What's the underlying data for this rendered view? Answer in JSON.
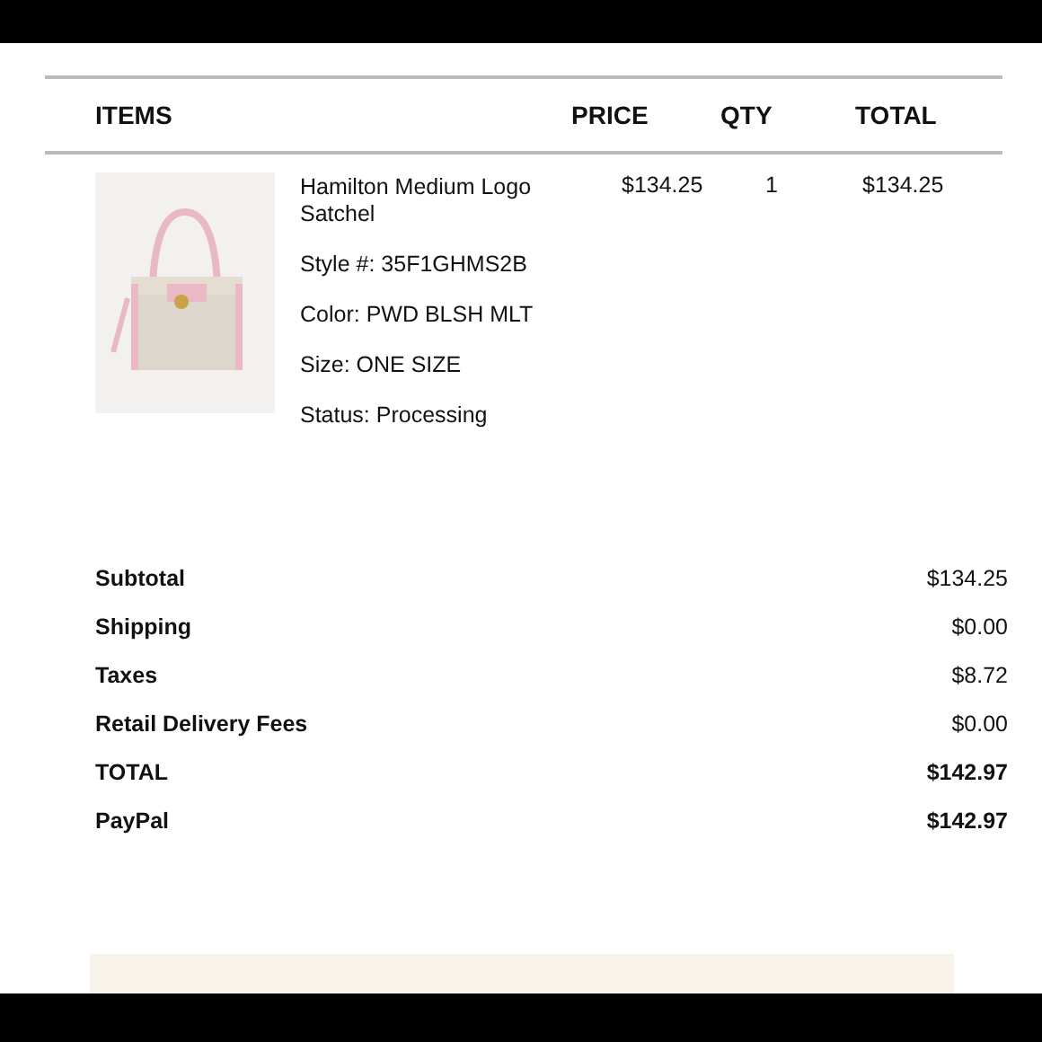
{
  "table": {
    "columns": [
      "ITEMS",
      "PRICE",
      "QTY",
      "TOTAL"
    ],
    "rows": [
      {
        "name": "Hamilton Medium Logo Satchel",
        "details": [
          "Style #: 35F1GHMS2B",
          "Color: PWD BLSH MLT",
          "Size: ONE SIZE",
          "Status: Processing"
        ],
        "price": "$134.25",
        "qty": "1",
        "total": "$134.25"
      }
    ]
  },
  "summary": [
    {
      "label": "Subtotal",
      "value": "$134.25",
      "emphasis": false
    },
    {
      "label": "Shipping",
      "value": "$0.00",
      "emphasis": false
    },
    {
      "label": "Taxes",
      "value": "$8.72",
      "emphasis": false
    },
    {
      "label": "Retail Delivery Fees",
      "value": "$0.00",
      "emphasis": false
    },
    {
      "label": "TOTAL",
      "value": "$142.97",
      "emphasis": true
    },
    {
      "label": "PayPal",
      "value": "$142.97",
      "emphasis": true
    }
  ]
}
